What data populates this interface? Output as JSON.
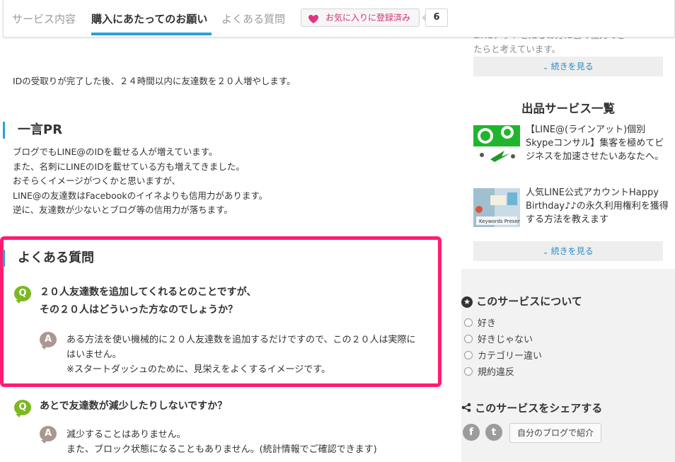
{
  "tabs": [
    {
      "label": "サービス内容"
    },
    {
      "label": "購入にあたってのお願い"
    },
    {
      "label": "よくある質問"
    }
  ],
  "favorite": {
    "label": "お気に入りに登録済み",
    "count": "6"
  },
  "main": {
    "intro_text": "IDの受取りが完了した後、２４時間以内に友達数を２０人増やします。",
    "pr": {
      "heading": "一言PR",
      "lines": [
        "ブログでもLINE@のIDを載せる人が増えています。",
        "また、名刺にLINEのIDを載せている方も増えてきました。",
        "おそらくイメージがつくかと思いますが、",
        "LINE@の友達数はFacebookのイイネよりも信用力があります。",
        "逆に、友達数が少ないとブログ等の信用力が落ちます。"
      ]
    },
    "faq": {
      "heading": "よくある質問",
      "q_badge": "Q",
      "a_badge": "A",
      "items": [
        {
          "question": [
            "２０人友達数を追加してくれるとのことですが、",
            "その２０人はどういった方なのでしょうか？"
          ],
          "answer": [
            "ある方法を使い機械的に２０人友達数を追加するだけですので、この２０人は実際に",
            "はいません。",
            "※スタートダッシュのために、見栄えをよくするイメージです。"
          ]
        },
        {
          "question": [
            "あとで友達数が減少したりしないですか？"
          ],
          "answer": [
            "減少することはありません。",
            "また、ブロック状態になることもありません。(統計情報でご確認できます)"
          ]
        }
      ]
    }
  },
  "sidebar": {
    "faded_lines": [
      "LINEアットを知るあ方に色く協力でき",
      "たらと考えています。"
    ],
    "more_label": "続きを見る",
    "services_heading": "出品サービス一覧",
    "services": [
      {
        "title": "【LINE@(ラインアット)個別Skypeコンサル】集客を極めてビジネスを加速させたいあなたへ。"
      },
      {
        "title": "人気LINE公式アカウントHappy Birthday♪♪の永久利用権利を獲得する方法を教えます"
      }
    ],
    "thumb2_caption": "Keywords Present",
    "about": {
      "title": "このサービスについて",
      "options": [
        "好き",
        "好きじゃない",
        "カテゴリー違い",
        "規約違反"
      ]
    },
    "share": {
      "title": "このサービスをシェアする",
      "facebook": "f",
      "twitter": "t",
      "blog_label": "自分のブログで紹介"
    }
  },
  "colors": {
    "accent": "#2aa1d8",
    "highlight": "#ff1d72",
    "q_badge": "#7cb821",
    "a_badge": "#a99790",
    "link": "#2a8cc7"
  }
}
